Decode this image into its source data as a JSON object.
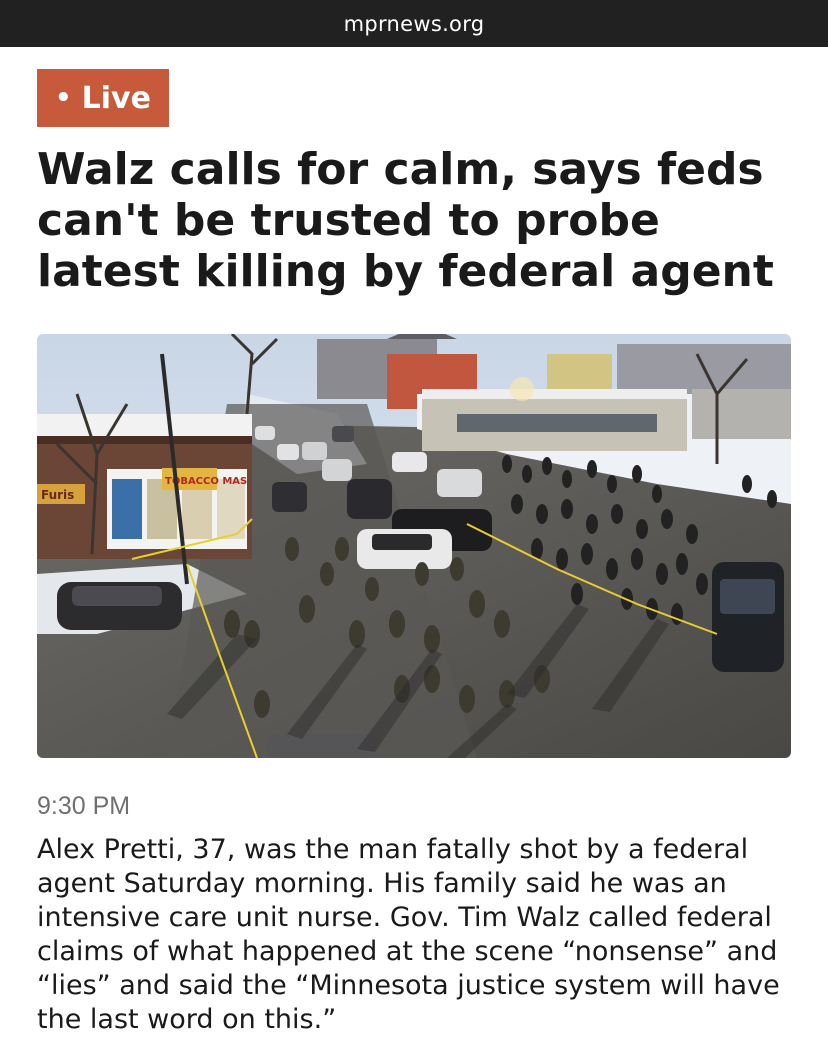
{
  "browser": {
    "url": "mprnews.org"
  },
  "article": {
    "badge_label": "Live",
    "headline": "Walz calls for calm, says feds can't be trusted to probe latest killing by federal agent",
    "photo_icon": "news-photo",
    "time": "9:30 PM",
    "summary": "Alex Pretti, 37, was the man fatally shot by a federal agent Saturday morning. His family said he was an intensive care unit nurse. Gov. Tim Walz called federal claims of what happened at the scene “nonsense” and “lies” and said the “Minnesota justice system will have the last word on this.”",
    "photo_signs": {
      "shop_left": "Furis",
      "shop_sign": "TOBACCO MAS"
    }
  },
  "colors": {
    "url_bar": "#212121",
    "badge": "#c85a3c",
    "text": "#1a1a1a",
    "muted": "#707070"
  }
}
